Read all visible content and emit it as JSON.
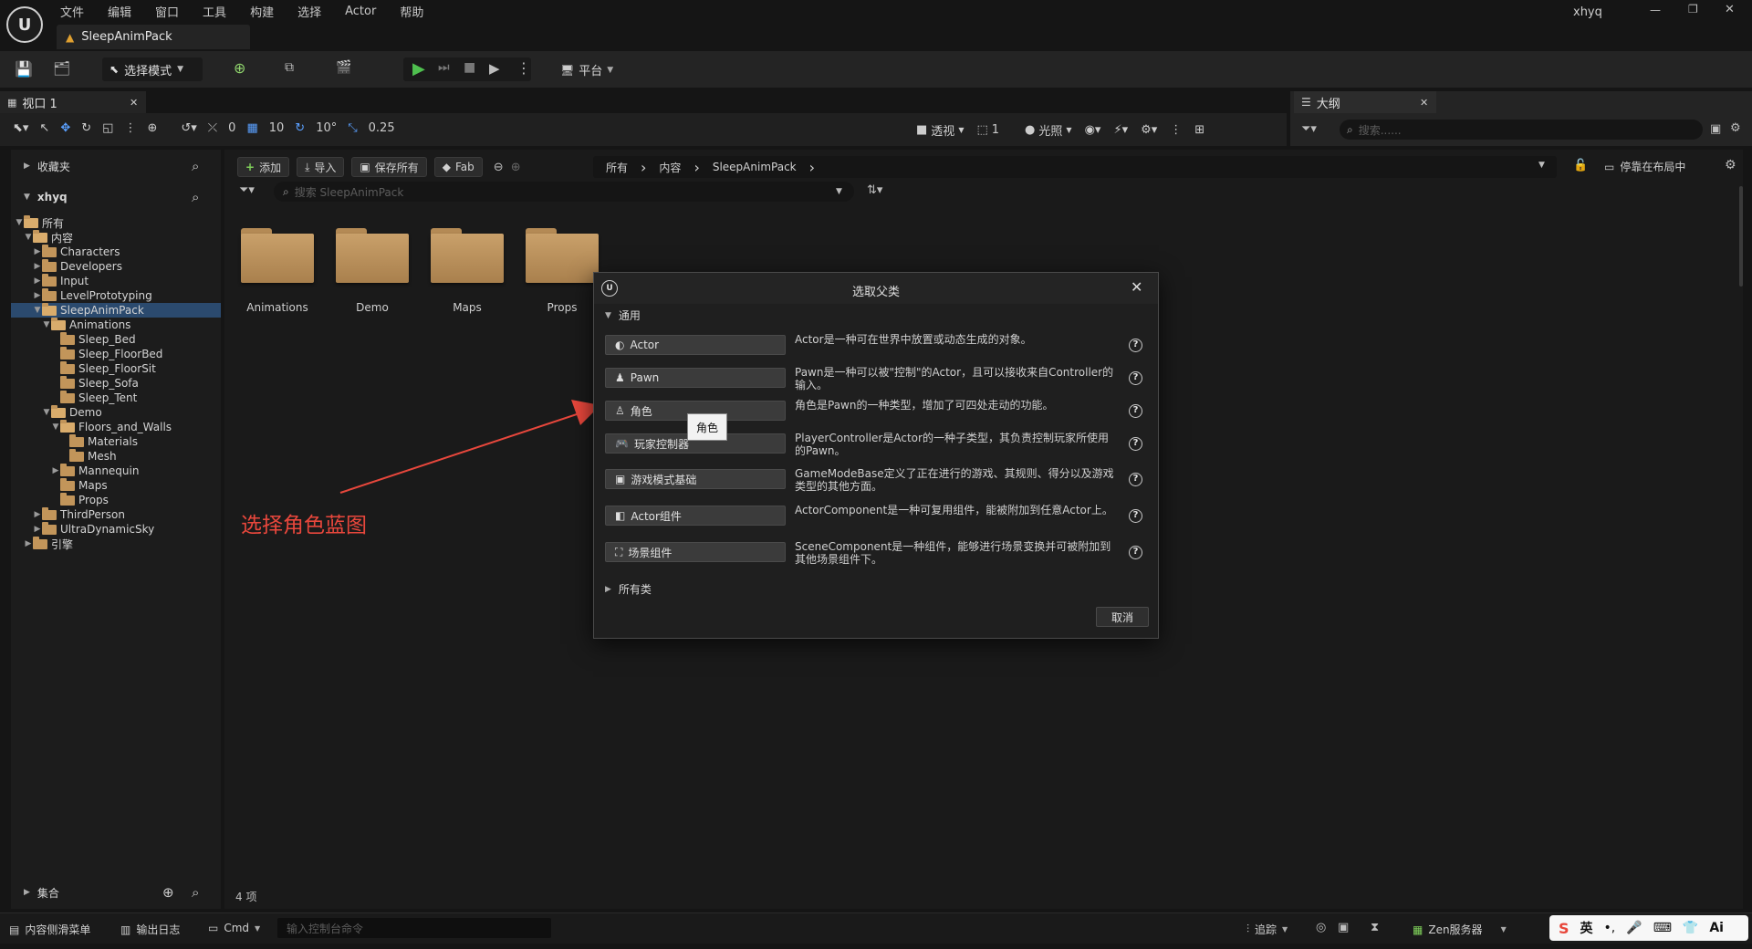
{
  "menubar": {
    "items": [
      "文件",
      "编辑",
      "窗口",
      "工具",
      "构建",
      "选择",
      "Actor",
      "帮助"
    ],
    "user": "xhyq",
    "project_tab": "SleepAnimPack"
  },
  "toolbar": {
    "mode_label": "选择模式",
    "platform_label": "平台"
  },
  "viewport": {
    "tab_label": "视口 1",
    "snap_move": "0",
    "grid": "10",
    "rotate": "10°",
    "scale": "0.25",
    "perspective": "透视",
    "count": "1",
    "lit": "光照"
  },
  "outliner": {
    "tab_label": "大纲",
    "search_placeholder": "搜索......"
  },
  "left_panel": {
    "favorites": "收藏夹",
    "user": "xhyq",
    "collections": "集合",
    "tree": [
      {
        "label": "所有",
        "depth": 0,
        "open": true
      },
      {
        "label": "内容",
        "depth": 1,
        "open": true
      },
      {
        "label": "Characters",
        "depth": 2,
        "open": false
      },
      {
        "label": "Developers",
        "depth": 2,
        "open": false
      },
      {
        "label": "Input",
        "depth": 2,
        "open": false
      },
      {
        "label": "LevelPrototyping",
        "depth": 2,
        "open": false
      },
      {
        "label": "SleepAnimPack",
        "depth": 2,
        "open": true,
        "selected": true
      },
      {
        "label": "Animations",
        "depth": 3,
        "open": true
      },
      {
        "label": "Sleep_Bed",
        "depth": 4,
        "leaf": true
      },
      {
        "label": "Sleep_FloorBed",
        "depth": 4,
        "leaf": true
      },
      {
        "label": "Sleep_FloorSit",
        "depth": 4,
        "leaf": true
      },
      {
        "label": "Sleep_Sofa",
        "depth": 4,
        "leaf": true
      },
      {
        "label": "Sleep_Tent",
        "depth": 4,
        "leaf": true
      },
      {
        "label": "Demo",
        "depth": 3,
        "open": true
      },
      {
        "label": "Floors_and_Walls",
        "depth": 4,
        "open": true
      },
      {
        "label": "Materials",
        "depth": 5,
        "leaf": true
      },
      {
        "label": "Mesh",
        "depth": 5,
        "leaf": true
      },
      {
        "label": "Mannequin",
        "depth": 4,
        "open": false
      },
      {
        "label": "Maps",
        "depth": 4,
        "leaf": true
      },
      {
        "label": "Props",
        "depth": 4,
        "leaf": true
      },
      {
        "label": "ThirdPerson",
        "depth": 2,
        "open": false
      },
      {
        "label": "UltraDynamicSky",
        "depth": 2,
        "open": false
      },
      {
        "label": "引擎",
        "depth": 1,
        "open": false
      }
    ]
  },
  "content": {
    "add": "添加",
    "import": "导入",
    "save_all": "保存所有",
    "fab": "Fab",
    "breadcrumb": [
      "所有",
      "内容",
      "SleepAnimPack"
    ],
    "search_placeholder": "搜索 SleepAnimPack",
    "dock_label": "停靠在布局中",
    "folders": [
      "Animations",
      "Demo",
      "Maps",
      "Props"
    ],
    "item_count": "4 项"
  },
  "annotation": "选择角色蓝图",
  "dialog": {
    "title": "选取父类",
    "section": "通用",
    "classes": [
      {
        "name": "Actor",
        "desc": "Actor是一种可在世界中放置或动态生成的对象。"
      },
      {
        "name": "Pawn",
        "desc": "Pawn是一种可以被\"控制\"的Actor，且可以接收来自Controller的输入。"
      },
      {
        "name": "角色",
        "desc": "角色是Pawn的一种类型，增加了可四处走动的功能。"
      },
      {
        "name": "玩家控制器",
        "desc": "PlayerController是Actor的一种子类型，其负责控制玩家所使用的Pawn。"
      },
      {
        "name": "游戏模式基础",
        "desc": "GameModeBase定义了正在进行的游戏、其规则、得分以及游戏类型的其他方面。"
      },
      {
        "name": "Actor组件",
        "desc": "ActorComponent是一种可复用组件，能被附加到任意Actor上。"
      },
      {
        "name": "场景组件",
        "desc": "SceneComponent是一种组件，能够进行场景变换并可被附加到其他场景组件下。"
      }
    ],
    "tooltip": "角色",
    "all_classes": "所有类",
    "cancel": "取消"
  },
  "statusbar": {
    "drawer": "内容侧滑菜单",
    "output_log": "输出日志",
    "cmd": "Cmd",
    "console_placeholder": "输入控制台命令",
    "trace": "追踪",
    "zen": "Zen服务器",
    "ime_lang": "英"
  }
}
